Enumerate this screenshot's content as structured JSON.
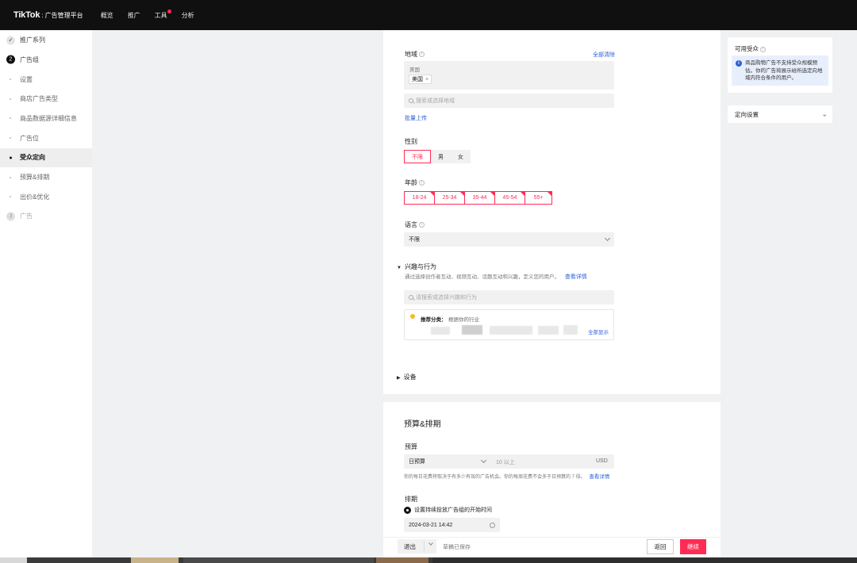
{
  "topbar": {
    "logo_main": "TikTok",
    "logo_sub": ": 广告管理平台",
    "nav": [
      "概览",
      "推广",
      "工具",
      "分析"
    ]
  },
  "sidebar": {
    "items": [
      {
        "label": "推广系列",
        "kind": "done"
      },
      {
        "label": "广告组",
        "kind": "step",
        "num": "2"
      },
      {
        "label": "设置",
        "kind": "sub"
      },
      {
        "label": "商店广告类型",
        "kind": "sub"
      },
      {
        "label": "商品数据源详细信息",
        "kind": "sub"
      },
      {
        "label": "广告位",
        "kind": "sub"
      },
      {
        "label": "受众定向",
        "kind": "active"
      },
      {
        "label": "预算&排期",
        "kind": "sub"
      },
      {
        "label": "出价&优化",
        "kind": "sub"
      },
      {
        "label": "广告",
        "kind": "step-disabled",
        "num": "3"
      }
    ]
  },
  "targeting": {
    "location_label": "地域",
    "clear_all": "全部清除",
    "location_group": "美国",
    "location_tag": "美国",
    "location_search_placeholder": "搜索或选择地域",
    "bulk_upload": "批量上传",
    "gender_label": "性别",
    "gender_options": [
      "不限",
      "男",
      "女"
    ],
    "gender_selected": "不限",
    "age_label": "年龄",
    "age_options": [
      "18-24",
      "25-34",
      "35-44",
      "45-54",
      "55+"
    ],
    "language_label": "语言",
    "language_value": "不限",
    "interest_title": "兴趣与行为",
    "interest_desc": "通过选择创作者互动、视频互动、话题互动和兴趣，定义您的用户。",
    "interest_link": "查看详情",
    "interest_search_placeholder": "请搜索或选择兴趣和行为",
    "recommend_label": "推荐分类：",
    "recommend_sub": "根据你的行业",
    "show_all": "全部显示",
    "device_label": "设备"
  },
  "budget": {
    "title": "预算&排期",
    "budget_label": "预算",
    "budget_type": "日预算",
    "amount_placeholder": "10 以上",
    "currency": "USD",
    "note": "你的每日花费将取决于有多少有效的广告机会。你的每周花费不会多于日预算的 7 倍。",
    "note_link": "查看详情",
    "schedule_label": "排期",
    "schedule_option": "设置持续投放广告组的开始时间",
    "start_time": "2024-03-21 14:42"
  },
  "right_panel": {
    "available_audience_title": "可用受众",
    "note": "商品购物广告不支持受众规模预估。你的广告将展示给所选定向地域内符合条件的用户。",
    "targeting_settings": "定向设置"
  },
  "footer": {
    "exit": "退出",
    "draft_saved": "草稿已保存",
    "back": "返回",
    "continue": "继续"
  },
  "colors": {
    "accent": "#fe2c55",
    "link": "#2b5fd9"
  }
}
